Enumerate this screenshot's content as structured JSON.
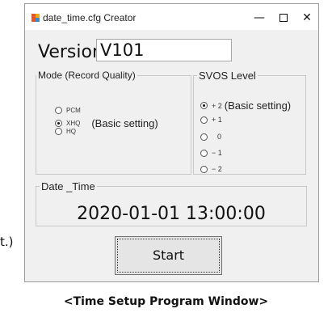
{
  "side_fragment": "t.)",
  "window": {
    "title": "date_time.cfg Creator",
    "minimize_glyph": "—",
    "close_glyph": "✕",
    "icon": "app-icon"
  },
  "version": {
    "label": "Version.",
    "value": "V101"
  },
  "mode": {
    "legend": "Mode (Record Quality)",
    "options": [
      "PCM",
      "XHQ",
      "HQ"
    ],
    "selected": "XHQ",
    "note": "(Basic setting)"
  },
  "svos": {
    "legend": "SVOS Level",
    "options": [
      "+ 2",
      "+ 1",
      "0",
      "− 1",
      "− 2"
    ],
    "selected": "+ 2",
    "note": "(Basic setting)"
  },
  "datetime": {
    "legend": "Date _Time",
    "value": "2020-01-01  13:00:00"
  },
  "start_label": "Start",
  "caption": "<Time Setup Program Window>"
}
